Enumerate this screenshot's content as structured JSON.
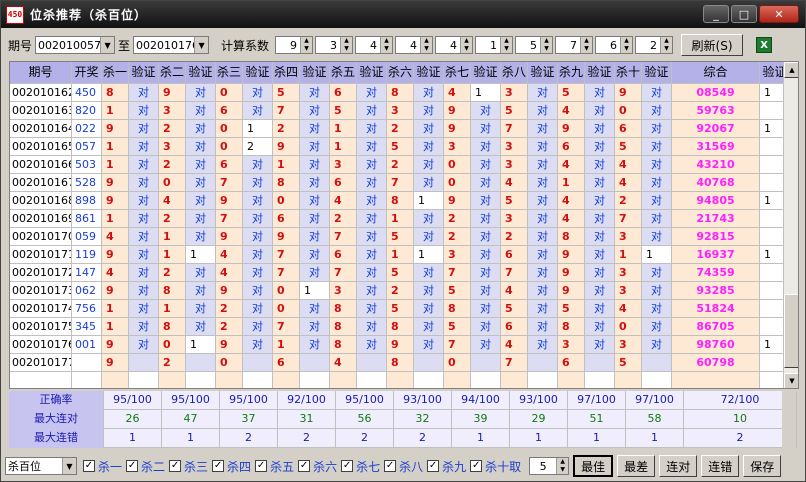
{
  "window": {
    "title": "位杀推荐（杀百位）",
    "icon": "450-app-icon",
    "min": "_",
    "max": "□",
    "close": "✕"
  },
  "toolbar": {
    "period_label": "期号",
    "period_from": "002010057",
    "to_label": "至",
    "period_to": "002010176",
    "coef_label": "计算系数",
    "coefs": [
      "9",
      "3",
      "4",
      "4",
      "4",
      "1",
      "5",
      "7",
      "6",
      "2"
    ],
    "refresh": "刷新(S)",
    "excel_icon": "excel-icon"
  },
  "grid": {
    "headers": [
      "期号",
      "开奖",
      "杀一",
      "验证",
      "杀二",
      "验证",
      "杀三",
      "验证",
      "杀四",
      "验证",
      "杀五",
      "验证",
      "杀六",
      "验证",
      "杀七",
      "验证",
      "杀八",
      "验证",
      "杀九",
      "验证",
      "杀十",
      "验证",
      "综合",
      "验证"
    ],
    "rows": [
      {
        "period": "002010162",
        "draw": "450",
        "kills": [
          "8",
          "9",
          "0",
          "5",
          "6",
          "8",
          "4",
          "3",
          "5",
          "9"
        ],
        "checks": [
          "对",
          "对",
          "对",
          "对",
          "对",
          "对",
          "1",
          "对",
          "对",
          "对"
        ],
        "sum": "08549",
        "sumcheck": "1"
      },
      {
        "period": "002010163",
        "draw": "820",
        "kills": [
          "1",
          "3",
          "6",
          "7",
          "5",
          "3",
          "9",
          "5",
          "4",
          "0"
        ],
        "checks": [
          "对",
          "对",
          "对",
          "对",
          "对",
          "对",
          "对",
          "对",
          "对",
          "对"
        ],
        "sum": "59763",
        "sumcheck": ""
      },
      {
        "period": "002010164",
        "draw": "022",
        "kills": [
          "9",
          "2",
          "0",
          "2",
          "1",
          "2",
          "9",
          "7",
          "9",
          "6"
        ],
        "checks": [
          "对",
          "对",
          "1",
          "对",
          "对",
          "对",
          "对",
          "对",
          "对",
          "对"
        ],
        "sum": "92067",
        "sumcheck": "1"
      },
      {
        "period": "002010165",
        "draw": "057",
        "kills": [
          "1",
          "3",
          "0",
          "9",
          "1",
          "5",
          "3",
          "3",
          "6",
          "5"
        ],
        "checks": [
          "对",
          "对",
          "2",
          "对",
          "对",
          "对",
          "对",
          "对",
          "对",
          "对"
        ],
        "sum": "31569",
        "sumcheck": ""
      },
      {
        "period": "002010166",
        "draw": "503",
        "kills": [
          "1",
          "2",
          "6",
          "1",
          "3",
          "2",
          "0",
          "3",
          "4",
          "4"
        ],
        "checks": [
          "对",
          "对",
          "对",
          "对",
          "对",
          "对",
          "对",
          "对",
          "对",
          "对"
        ],
        "sum": "43210",
        "sumcheck": ""
      },
      {
        "period": "002010167",
        "draw": "528",
        "kills": [
          "9",
          "0",
          "7",
          "8",
          "6",
          "7",
          "0",
          "4",
          "1",
          "4"
        ],
        "checks": [
          "对",
          "对",
          "对",
          "对",
          "对",
          "对",
          "对",
          "对",
          "对",
          "对"
        ],
        "sum": "40768",
        "sumcheck": ""
      },
      {
        "period": "002010168",
        "draw": "898",
        "kills": [
          "9",
          "4",
          "9",
          "0",
          "4",
          "8",
          "9",
          "5",
          "4",
          "2"
        ],
        "checks": [
          "对",
          "对",
          "对",
          "对",
          "对",
          "1",
          "对",
          "对",
          "对",
          "对"
        ],
        "sum": "94805",
        "sumcheck": "1"
      },
      {
        "period": "002010169",
        "draw": "861",
        "kills": [
          "1",
          "2",
          "7",
          "6",
          "2",
          "1",
          "2",
          "3",
          "4",
          "7"
        ],
        "checks": [
          "对",
          "对",
          "对",
          "对",
          "对",
          "对",
          "对",
          "对",
          "对",
          "对"
        ],
        "sum": "21743",
        "sumcheck": ""
      },
      {
        "period": "002010170",
        "draw": "059",
        "kills": [
          "4",
          "1",
          "9",
          "9",
          "7",
          "5",
          "2",
          "2",
          "8",
          "3"
        ],
        "checks": [
          "对",
          "对",
          "对",
          "对",
          "对",
          "对",
          "对",
          "对",
          "对",
          "对"
        ],
        "sum": "92815",
        "sumcheck": ""
      },
      {
        "period": "002010171",
        "draw": "119",
        "kills": [
          "9",
          "1",
          "4",
          "7",
          "6",
          "1",
          "3",
          "6",
          "9",
          "1"
        ],
        "checks": [
          "对",
          "1",
          "对",
          "对",
          "对",
          "1",
          "对",
          "对",
          "对",
          "1"
        ],
        "sum": "16937",
        "sumcheck": "1"
      },
      {
        "period": "002010172",
        "draw": "147",
        "kills": [
          "4",
          "2",
          "4",
          "7",
          "7",
          "5",
          "7",
          "7",
          "9",
          "3"
        ],
        "checks": [
          "对",
          "对",
          "对",
          "对",
          "对",
          "对",
          "对",
          "对",
          "对",
          "对"
        ],
        "sum": "74359",
        "sumcheck": ""
      },
      {
        "period": "002010173",
        "draw": "062",
        "kills": [
          "9",
          "8",
          "9",
          "0",
          "3",
          "2",
          "5",
          "4",
          "9",
          "3"
        ],
        "checks": [
          "对",
          "对",
          "对",
          "1",
          "对",
          "对",
          "对",
          "对",
          "对",
          "对"
        ],
        "sum": "93285",
        "sumcheck": ""
      },
      {
        "period": "002010174",
        "draw": "756",
        "kills": [
          "1",
          "1",
          "2",
          "0",
          "8",
          "5",
          "8",
          "5",
          "5",
          "4"
        ],
        "checks": [
          "对",
          "对",
          "对",
          "对",
          "对",
          "对",
          "对",
          "对",
          "对",
          "对"
        ],
        "sum": "51824",
        "sumcheck": ""
      },
      {
        "period": "002010175",
        "draw": "345",
        "kills": [
          "1",
          "8",
          "2",
          "7",
          "8",
          "8",
          "5",
          "6",
          "8",
          "0"
        ],
        "checks": [
          "对",
          "对",
          "对",
          "对",
          "对",
          "对",
          "对",
          "对",
          "对",
          "对"
        ],
        "sum": "86705",
        "sumcheck": ""
      },
      {
        "period": "002010176",
        "draw": "001",
        "kills": [
          "9",
          "0",
          "9",
          "1",
          "8",
          "9",
          "7",
          "4",
          "3",
          "3"
        ],
        "checks": [
          "对",
          "1",
          "对",
          "对",
          "对",
          "对",
          "对",
          "对",
          "对",
          "对"
        ],
        "sum": "98760",
        "sumcheck": "1"
      },
      {
        "period": "002010177",
        "draw": "",
        "kills": [
          "9",
          "2",
          "0",
          "6",
          "4",
          "8",
          "0",
          "7",
          "6",
          "5"
        ],
        "checks": [
          "",
          "",
          "",
          "",
          "",
          "",
          "",
          "",
          "",
          ""
        ],
        "sum": "60798",
        "sumcheck": ""
      },
      {
        "period": "",
        "draw": "",
        "kills": [
          "",
          "",
          "",
          "",
          "",
          "",
          "",
          "",
          "",
          ""
        ],
        "checks": [
          "",
          "",
          "",
          "",
          "",
          "",
          "",
          "",
          "",
          ""
        ],
        "sum": "",
        "sumcheck": ""
      }
    ]
  },
  "stats": {
    "labels": [
      "正确率",
      "最大连对",
      "最大连错"
    ],
    "accuracy": [
      "95/100",
      "95/100",
      "95/100",
      "92/100",
      "95/100",
      "93/100",
      "94/100",
      "93/100",
      "97/100",
      "97/100",
      "72/100"
    ],
    "max_right": [
      "26",
      "47",
      "37",
      "31",
      "56",
      "32",
      "39",
      "29",
      "51",
      "58",
      "10"
    ],
    "max_wrong": [
      "1",
      "1",
      "2",
      "2",
      "2",
      "2",
      "1",
      "1",
      "1",
      "1",
      "2"
    ]
  },
  "bottom": {
    "position_select": "杀百位",
    "checkboxes": [
      "杀一",
      "杀二",
      "杀三",
      "杀四",
      "杀五",
      "杀六",
      "杀七",
      "杀八",
      "杀九",
      "杀十取"
    ],
    "take_count": "5",
    "buttons": {
      "best": "最佳",
      "worst": "最差",
      "right": "连对",
      "wrong": "连错",
      "save": "保存"
    }
  }
}
